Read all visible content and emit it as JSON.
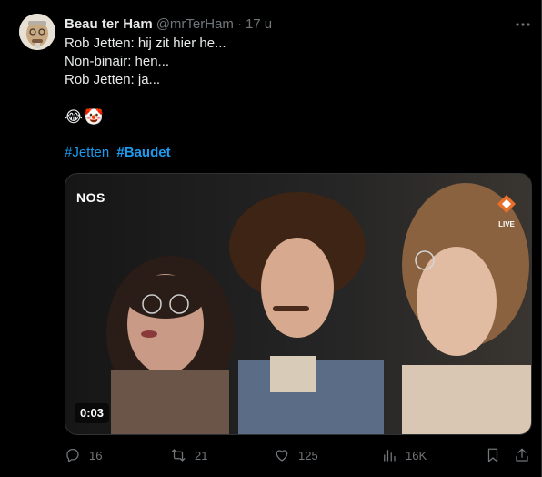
{
  "tweet": {
    "author_name": "Beau ter Ham",
    "author_handle": "@mrTerHam",
    "separator": "·",
    "time": "17 u",
    "lines": [
      "Rob Jetten: hij zit hier he...",
      "Non-binair: hen...",
      "Rob Jetten: ja..."
    ],
    "emojis": [
      "😂",
      "🤡"
    ],
    "hashtags": [
      "#Jetten",
      "#Baudet"
    ]
  },
  "media": {
    "type": "video",
    "watermark": "NOS",
    "live_label": "LIVE",
    "duration": "0:03"
  },
  "actions": {
    "replies": "16",
    "retweets": "21",
    "likes": "125",
    "views": "16K"
  },
  "colors": {
    "background": "#000000",
    "text": "#e7e9ea",
    "muted": "#71767b",
    "link": "#1d9bf0"
  },
  "icons": [
    "more-icon",
    "reply-icon",
    "retweet-icon",
    "like-icon",
    "views-icon",
    "bookmark-icon",
    "share-icon"
  ]
}
